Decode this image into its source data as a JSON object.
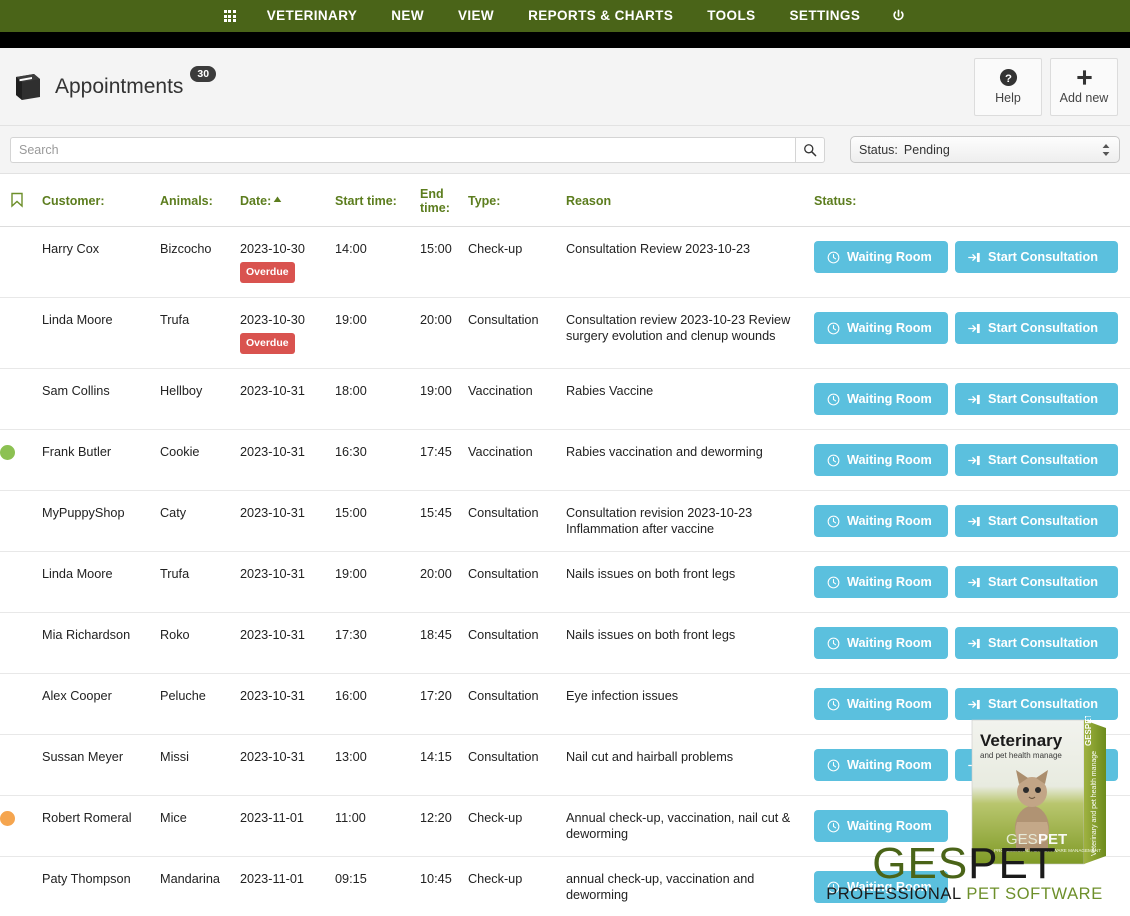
{
  "topnav": {
    "items": [
      {
        "label": "VETERINARY"
      },
      {
        "label": "NEW"
      },
      {
        "label": "VIEW"
      },
      {
        "label": "REPORTS & CHARTS"
      },
      {
        "label": "TOOLS"
      },
      {
        "label": "SETTINGS"
      }
    ],
    "apps_icon": "grid-icon",
    "power_icon": "power-icon",
    "background": "#4a6418"
  },
  "header": {
    "title": "Appointments",
    "count_badge": "30",
    "book_icon": "book-icon",
    "help_button": {
      "label": "Help",
      "icon": "question-circle-icon"
    },
    "add_new_button": {
      "label": "Add new",
      "icon": "plus-icon"
    }
  },
  "search": {
    "placeholder": "Search",
    "value": "",
    "button_icon": "search-icon"
  },
  "status_filter": {
    "label": "Status:",
    "value": "Pending",
    "icon": "updown-arrows-icon"
  },
  "table": {
    "columns": [
      {
        "label": ""
      },
      {
        "label": "Customer:"
      },
      {
        "label": "Animals:"
      },
      {
        "label": "Date:",
        "sorted": "asc"
      },
      {
        "label": "Start time:"
      },
      {
        "label": "End time:"
      },
      {
        "label": "Type:"
      },
      {
        "label": "Reason"
      },
      {
        "label": "Status:"
      }
    ],
    "flag_icon": "bookmark-icon",
    "rows": [
      {
        "dot": "",
        "customer": "Harry Cox",
        "animal": "Bizcocho",
        "date": "2023-10-30",
        "badge": "Overdue",
        "start": "14:00",
        "end": "15:00",
        "type": "Check-up",
        "reason": "Consultation Review 2023-10-23",
        "buttons": [
          "Waiting Room",
          "Start Consultation"
        ]
      },
      {
        "dot": "",
        "customer": "Linda Moore",
        "animal": "Trufa",
        "date": "2023-10-30",
        "badge": "Overdue",
        "start": "19:00",
        "end": "20:00",
        "type": "Consultation",
        "reason": "Consultation review 2023-10-23 Review surgery evolution and clenup  wounds",
        "buttons": [
          "Waiting Room",
          "Start Consultation"
        ]
      },
      {
        "dot": "",
        "customer": "Sam Collins",
        "animal": "Hellboy",
        "date": "2023-10-31",
        "badge": "",
        "start": "18:00",
        "end": "19:00",
        "type": "Vaccination",
        "reason": "Rabies Vaccine",
        "buttons": [
          "Waiting Room",
          "Start Consultation"
        ]
      },
      {
        "dot": "green",
        "customer": "Frank Butler",
        "animal": "Cookie",
        "date": "2023-10-31",
        "badge": "",
        "start": "16:30",
        "end": "17:45",
        "type": "Vaccination",
        "reason": "Rabies vaccination and deworming",
        "buttons": [
          "Waiting Room",
          "Start Consultation"
        ]
      },
      {
        "dot": "",
        "customer": "MyPuppyShop",
        "animal": "Caty",
        "date": "2023-10-31",
        "badge": "",
        "start": "15:00",
        "end": "15:45",
        "type": "Consultation",
        "reason": "Consultation revision 2023-10-23 Inflammation after vaccine",
        "buttons": [
          "Waiting Room",
          "Start Consultation"
        ]
      },
      {
        "dot": "",
        "customer": "Linda Moore",
        "animal": "Trufa",
        "date": "2023-10-31",
        "badge": "",
        "start": "19:00",
        "end": "20:00",
        "type": "Consultation",
        "reason": "Nails issues on both front legs",
        "buttons": [
          "Waiting Room",
          "Start Consultation"
        ]
      },
      {
        "dot": "",
        "customer": "Mia Richardson",
        "animal": "Roko",
        "date": "2023-10-31",
        "badge": "",
        "start": "17:30",
        "end": "18:45",
        "type": "Consultation",
        "reason": "Nails issues on both front legs",
        "buttons": [
          "Waiting Room",
          "Start Consultation"
        ]
      },
      {
        "dot": "",
        "customer": "Alex Cooper",
        "animal": "Peluche",
        "date": "2023-10-31",
        "badge": "",
        "start": "16:00",
        "end": "17:20",
        "type": "Consultation",
        "reason": "Eye infection issues",
        "buttons": [
          "Waiting Room",
          "Start Consultation"
        ]
      },
      {
        "dot": "",
        "customer": "Sussan Meyer",
        "animal": "Missi",
        "date": "2023-10-31",
        "badge": "",
        "start": "13:00",
        "end": "14:15",
        "type": "Consultation",
        "reason": "Nail cut and hairball problems",
        "buttons": [
          "Waiting Room",
          "Start Consultation"
        ]
      },
      {
        "dot": "orange",
        "customer": "Robert Romeral",
        "animal": "Mice",
        "date": "2023-11-01",
        "badge": "",
        "start": "11:00",
        "end": "12:20",
        "type": "Check-up",
        "reason": "Annual check-up, vaccination, nail cut & deworming",
        "buttons": [
          "Waiting Room"
        ]
      },
      {
        "dot": "",
        "customer": "Paty Thompson",
        "animal": "Mandarina",
        "date": "2023-11-01",
        "badge": "",
        "start": "09:15",
        "end": "10:45",
        "type": "Check-up",
        "reason": "annual check-up, vaccination and deworming",
        "buttons": [
          "Waiting Room"
        ]
      }
    ]
  },
  "branding": {
    "logo_part1": "GES",
    "logo_part2": "PET",
    "tagline_part1": "PROFESSIONAL",
    "tagline_part2": "PET SOFTWARE",
    "box_title": "Veterinary",
    "box_subtitle": "and pet health manage",
    "box_spine": "Veterinary and pet health manage",
    "box_logo1": "GES",
    "box_logo2": "PET",
    "box_logo_sub": "PROFESSIONAL PET SOFTWARE MANAGEMENT"
  },
  "colors": {
    "nav_green": "#4a6418",
    "header_green": "#5c7d1e",
    "action_blue": "#5bc0de",
    "overdue_red": "#d9534f",
    "dot_green": "#8cc152",
    "dot_orange": "#f5a54f"
  }
}
